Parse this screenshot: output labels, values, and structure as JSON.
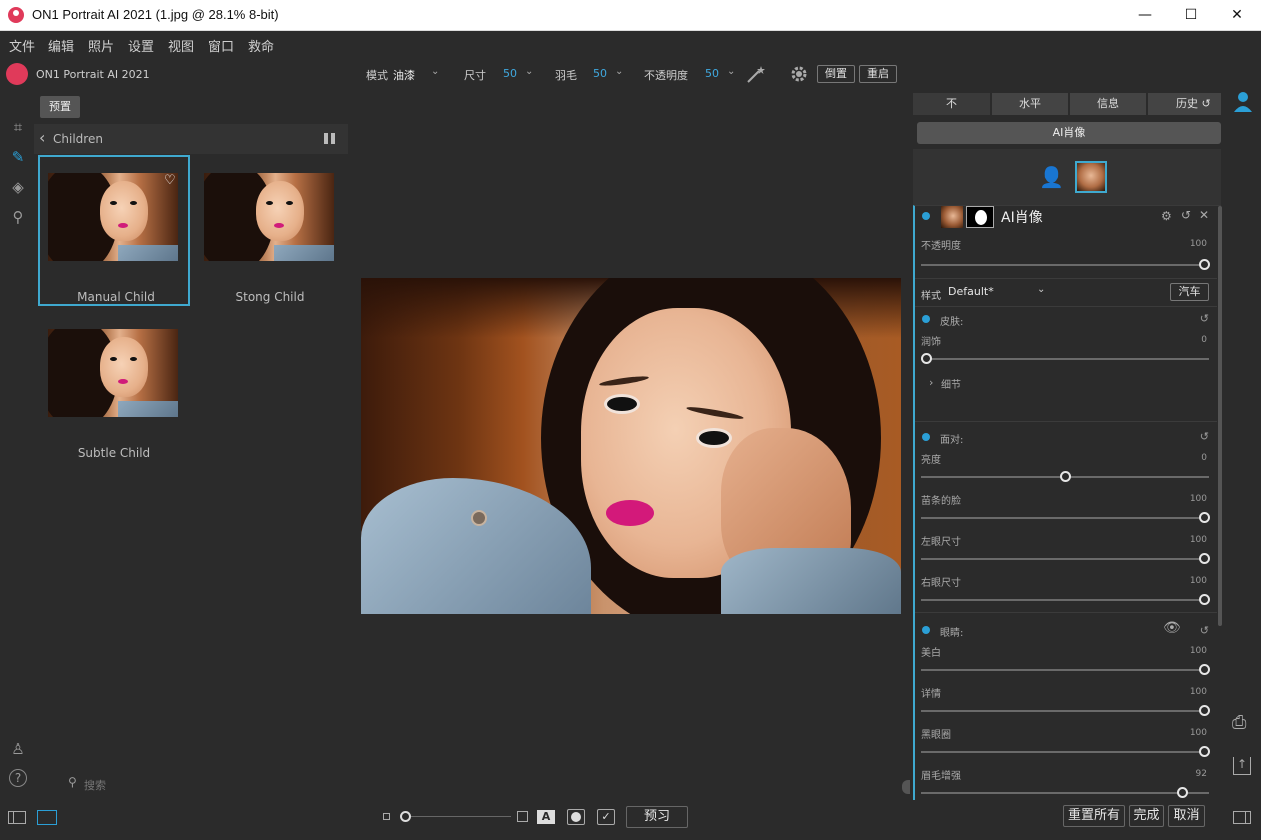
{
  "window": {
    "title": "ON1 Portrait AI 2021 (1.jpg @ 28.1% 8-bit)",
    "minimize": "—",
    "maximize": "☐",
    "close": "✕"
  },
  "menu": [
    "文件",
    "编辑",
    "照片",
    "设置",
    "视图",
    "窗口",
    "救命"
  ],
  "app": {
    "name": "ON1 Portrait AI 2021"
  },
  "toolbar": {
    "mode_label": "模式",
    "mode_value": "油漆",
    "size_label": "尺寸",
    "size_value": "50",
    "feather_label": "羽毛",
    "feather_value": "50",
    "opacity_label": "不透明度",
    "opacity_value": "50",
    "invert_label": "倒置",
    "reset_label": "重启"
  },
  "browser": {
    "presets_tab": "预置",
    "breadcrumb": "Children",
    "thumbnails": [
      {
        "label": "Manual Child"
      },
      {
        "label": "Stong Child"
      },
      {
        "label": "Subtle Child"
      }
    ],
    "search_placeholder": "搜索"
  },
  "right_panel": {
    "tabs": [
      "不",
      "水平",
      "信息",
      "历史"
    ],
    "ai_portrait_tab": "AI肖像",
    "layer_title": "AI肖像",
    "opacity_label": "不透明度",
    "opacity_value": "100",
    "style_label": "样式",
    "style_value": "Default*",
    "save_button": "汽车",
    "skin": {
      "title": "皮肤:",
      "retouch_label": "润饰",
      "retouch_value": "0",
      "details_label": "细节"
    },
    "face": {
      "title": "面对:",
      "rows": [
        {
          "label": "亮度",
          "value": "0",
          "pos": 0.5
        },
        {
          "label": "苗条的脸",
          "value": "100",
          "pos": 1.0
        },
        {
          "label": "左眼尺寸",
          "value": "100",
          "pos": 1.0
        },
        {
          "label": "右眼尺寸",
          "value": "100",
          "pos": 1.0
        }
      ]
    },
    "eyes": {
      "title": "眼睛:",
      "rows": [
        {
          "label": "美白",
          "value": "100",
          "pos": 1.0
        },
        {
          "label": "详情",
          "value": "100",
          "pos": 1.0
        },
        {
          "label": "黑眼圈",
          "value": "100",
          "pos": 1.0
        },
        {
          "label": "眉毛增强",
          "value": "92",
          "pos": 0.92
        }
      ]
    }
  },
  "bottom": {
    "preview_button": "预习",
    "reset_all_button": "重置所有",
    "done_button": "完成",
    "cancel_button": "取消"
  },
  "colors": {
    "accent": "#2b9fd6",
    "selection": "#3fa9cf",
    "background": "#2b2b2b",
    "lipstick": "#d01c7a"
  }
}
